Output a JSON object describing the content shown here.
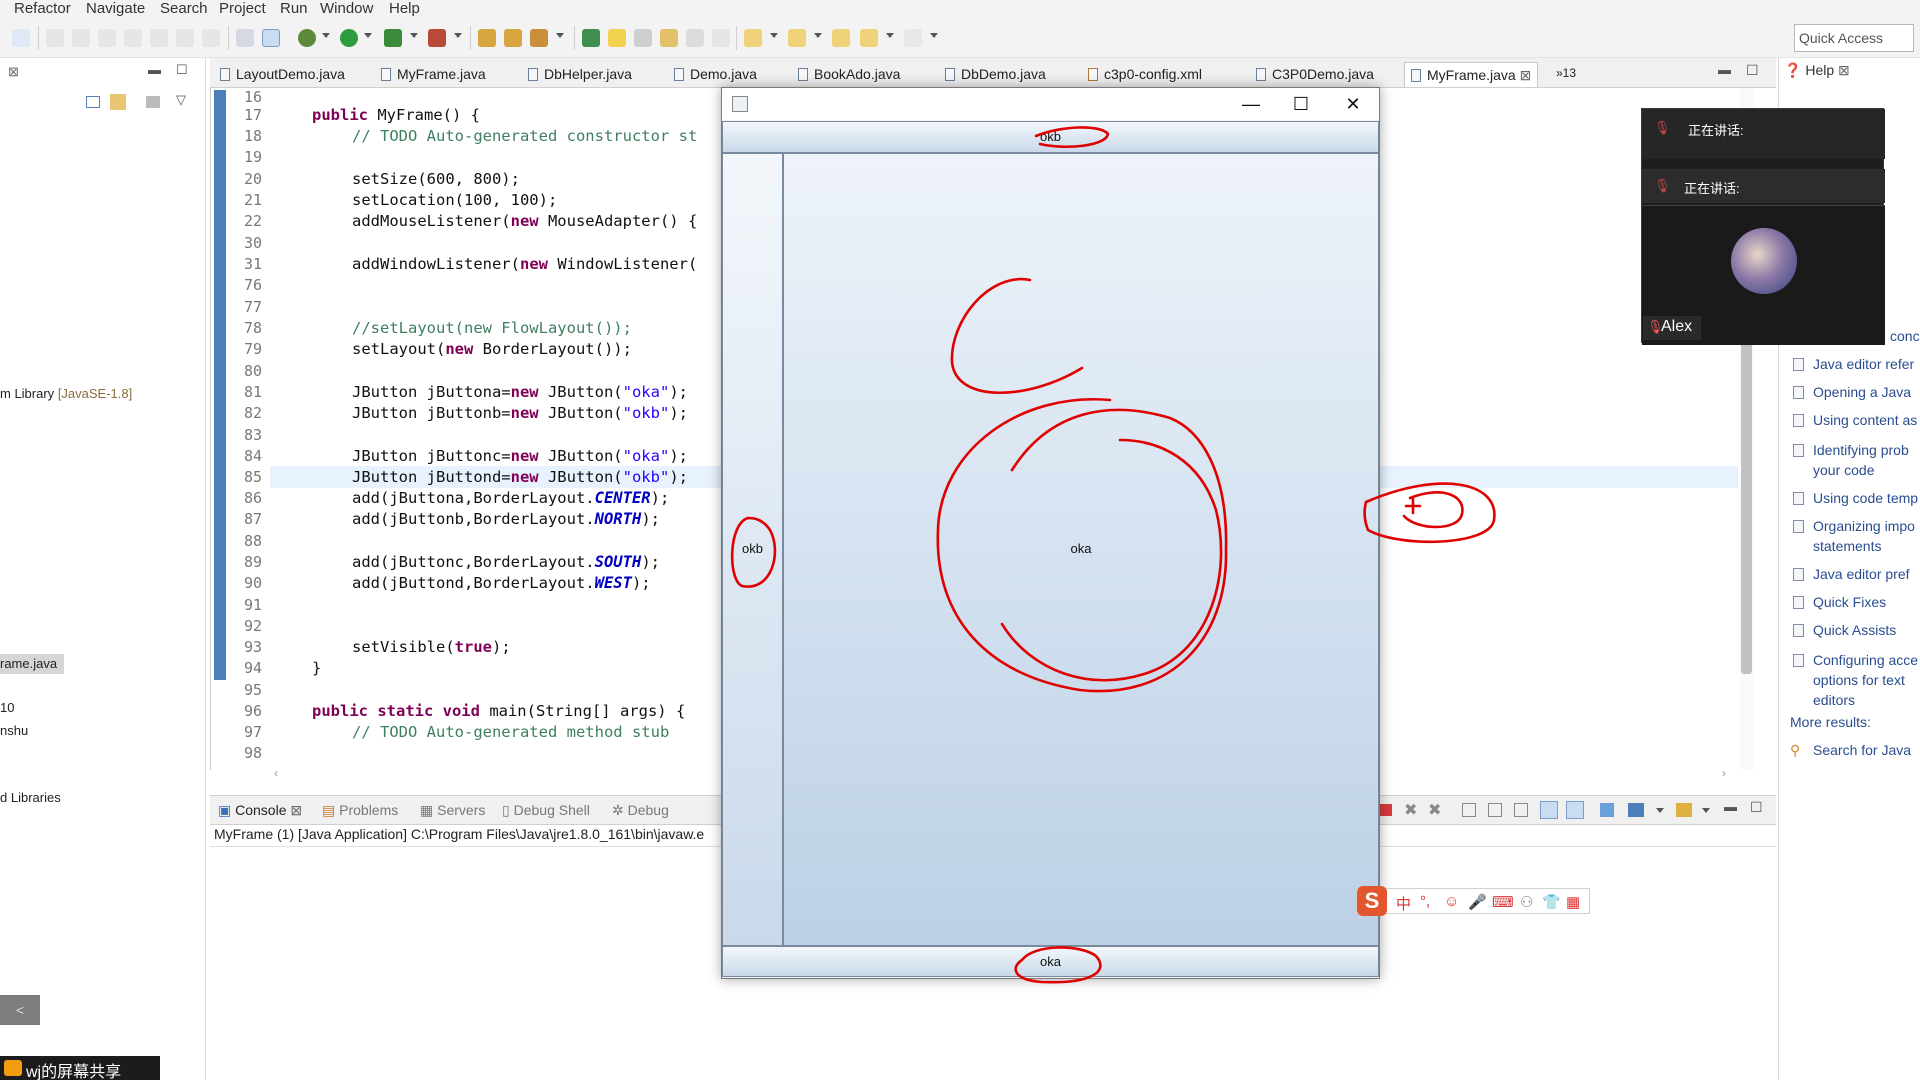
{
  "menubar": {
    "items": [
      "Refactor",
      "Navigate",
      "Search",
      "Project",
      "Run",
      "Window",
      "Help"
    ]
  },
  "toolbar": {
    "quick_access": "Quick Access"
  },
  "left_pane": {
    "jre": "m Library",
    "jre_ver": "[JavaSE-1.8]",
    "selected_file": "rame.java",
    "line_a": "10",
    "line_b": "nshu",
    "libraries": "d Libraries"
  },
  "editor": {
    "tabs": [
      "LayoutDemo.java",
      "MyFrame.java",
      "DbHelper.java",
      "Demo.java",
      "BookAdo.java",
      "DbDemo.java",
      "c3p0-config.xml",
      "C3P0Demo.java",
      "MyFrame.java"
    ],
    "overflow": "»13",
    "line_numbers": [
      "16",
      "17",
      "18",
      "19",
      "20",
      "21",
      "22",
      "30",
      "31",
      "76",
      "77",
      "78",
      "79",
      "80",
      "81",
      "82",
      "83",
      "84",
      "85",
      "86",
      "87",
      "88",
      "89",
      "90",
      "91",
      "92",
      "93",
      "94",
      "95",
      "96",
      "97",
      "98"
    ]
  },
  "console": {
    "tabs": [
      "Console",
      "Problems",
      "Servers",
      "Debug Shell",
      "Debug"
    ],
    "header": "MyFrame (1) [Java Application] C:\\Program Files\\Java\\jre1.8.0_161\\bin\\javaw.e"
  },
  "help": {
    "tab": "Help",
    "partial": "conc",
    "links": [
      "Java editor refer",
      "Opening a Java",
      "Using content as",
      "Identifying prob",
      "your code",
      "Using code temp",
      "Organizing impo",
      "statements",
      "Java editor pref",
      "Quick Fixes",
      "Quick Assists",
      "Configuring acce",
      "options for text",
      "editors"
    ],
    "more_results": "More results:",
    "search_link": "Search for Java"
  },
  "swing_frame": {
    "btn_north": "okb",
    "btn_west": "okb",
    "btn_center": "oka",
    "btn_south": "oka",
    "minimize": "—",
    "maximize": "☐",
    "close": "✕"
  },
  "meeting": {
    "speaking_1": "正在讲话:",
    "speaking_2": "正在讲话:",
    "participant": "Alex"
  },
  "ime": {
    "logo": "S",
    "mode": "中"
  },
  "share": {
    "label": "wj的屏幕共享"
  },
  "colors": {
    "keyword": "#7f0055",
    "comment": "#3f7f5f",
    "string": "#2a00ff",
    "static_field": "#0000c0",
    "ink": "#e00000",
    "gutter": "#4a7fb8"
  }
}
